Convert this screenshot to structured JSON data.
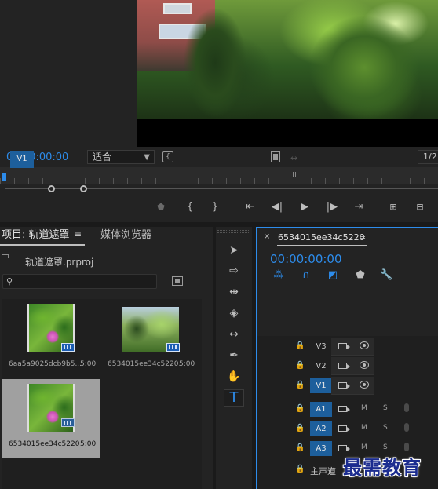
{
  "monitor": {
    "timecode": "01:00:00:00",
    "fit_value": "适合",
    "resolution": "1/2"
  },
  "project_panel": {
    "tab_project": "项目: 轨道遮罩",
    "menu_glyph": "≡",
    "tab_media": "媒体浏览器",
    "project_file": "轨道遮罩.prproj",
    "search_placeholder": "",
    "items": [
      {
        "name": "6aa5a9025dcb9b5...",
        "duration": "5:00",
        "selected": false
      },
      {
        "name": "6534015ee34c5220...",
        "duration": "5:00",
        "selected": false
      },
      {
        "name": "6534015ee34c5220",
        "duration": "5:00",
        "selected": true
      }
    ]
  },
  "timeline": {
    "close_glyph": "×",
    "sequence_name": "6534015ee34c5220",
    "menu_glyph": "≡",
    "timecode": "00:00:00:00",
    "source_patch": "V1",
    "video_tracks": [
      "V3",
      "V2",
      "V1"
    ],
    "audio_tracks": [
      "A1",
      "A2",
      "A3"
    ],
    "mute_label": "M",
    "solo_label": "S",
    "master_label": "主声道"
  },
  "watermark": "最需教育",
  "colors": {
    "accent": "#2d8ceb",
    "track_highlight": "#1d5f9c",
    "panel_bg": "#232323"
  }
}
